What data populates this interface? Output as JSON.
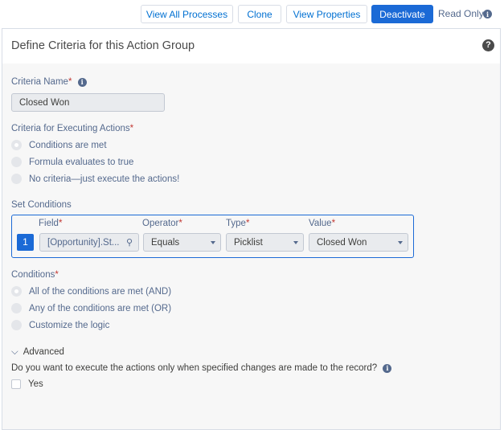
{
  "toolbar": {
    "view_all": "View All Processes",
    "clone": "Clone",
    "view_properties": "View Properties",
    "deactivate": "Deactivate",
    "read_only": "Read Only"
  },
  "panel": {
    "title": "Define Criteria for this Action Group"
  },
  "criteria_name": {
    "label": "Criteria Name",
    "value": "Closed Won"
  },
  "executing": {
    "label": "Criteria for Executing Actions",
    "options": [
      "Conditions are met",
      "Formula evaluates to true",
      "No criteria—just execute the actions!"
    ],
    "selected": 0
  },
  "set_conditions": {
    "label": "Set Conditions",
    "headers": {
      "field": "Field",
      "operator": "Operator",
      "type": "Type",
      "value": "Value"
    },
    "row": {
      "index": "1",
      "field": "[Opportunity].St...",
      "operator": "Equals",
      "type": "Picklist",
      "value": "Closed Won"
    }
  },
  "conditions": {
    "label": "Conditions",
    "options": [
      "All of the conditions are met (AND)",
      "Any of the conditions are met (OR)",
      "Customize the logic"
    ],
    "selected": 0
  },
  "advanced": {
    "label": "Advanced",
    "question": "Do you want to execute the actions only when specified changes are made to the record?",
    "yes": "Yes",
    "yes_checked": false
  },
  "colors": {
    "accent": "#1b6ad6",
    "required": "#c23934"
  }
}
